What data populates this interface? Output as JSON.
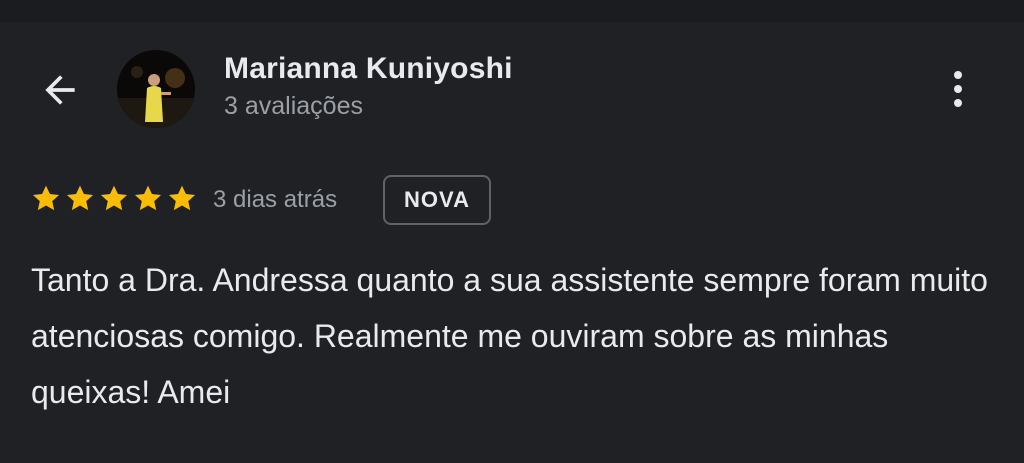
{
  "header": {
    "back_icon": "arrow-left-icon",
    "more_icon": "more-vert-icon",
    "user_name": "Marianna Kuniyoshi",
    "review_count": "3 avaliações"
  },
  "review": {
    "rating": 5,
    "rating_max": 5,
    "time": "3 dias atrás",
    "badge": "NOVA",
    "text": "Tanto a Dra. Andressa quanto a sua assistente sempre foram muito atenciosas comigo. Realmente me ouviram sobre as minhas queixas! Amei"
  },
  "colors": {
    "background": "#202124",
    "text_primary": "#e8eaed",
    "text_secondary": "#9aa0a6",
    "star": "#fbbc04",
    "badge_border": "#5f6368"
  }
}
